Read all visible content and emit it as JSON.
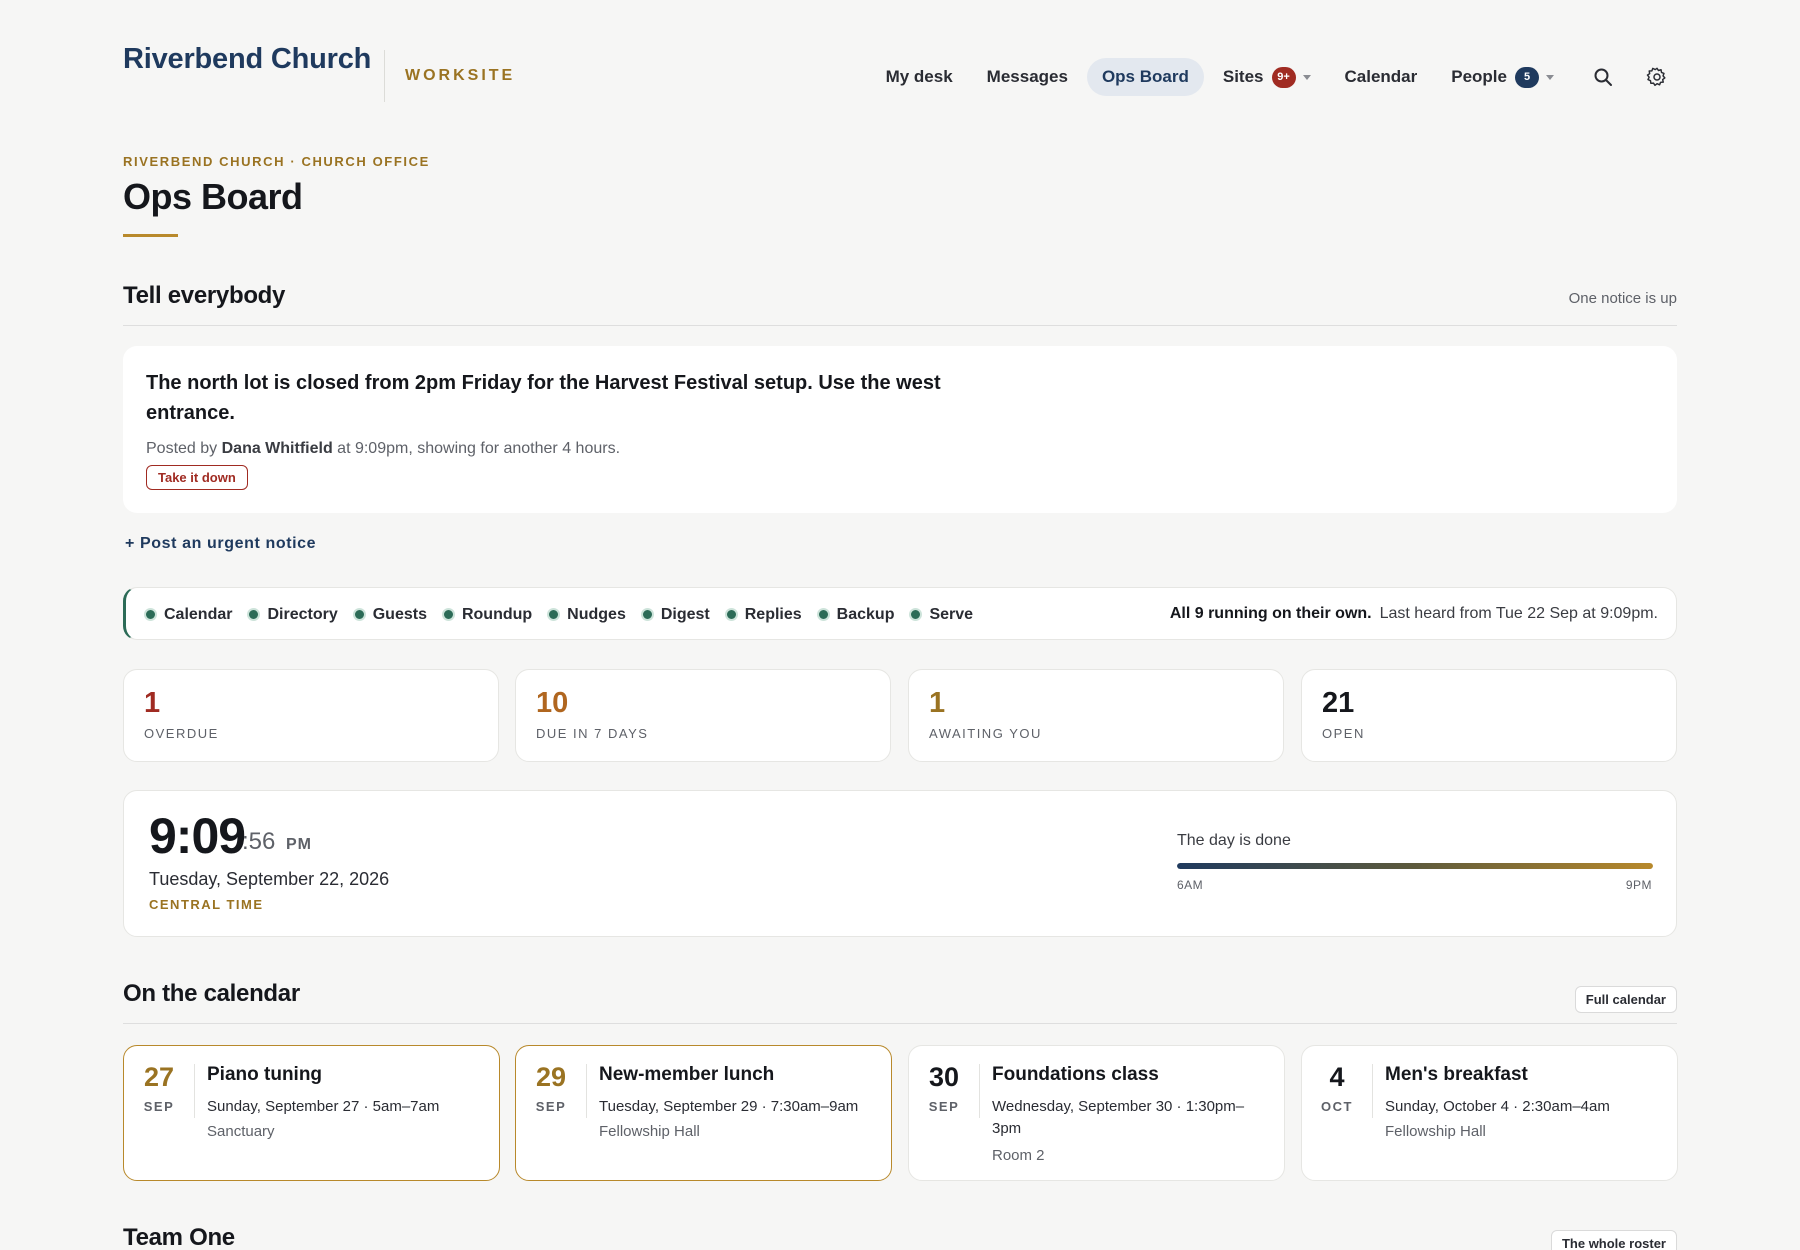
{
  "header": {
    "brand": "Riverbend Church",
    "brand_sub": "WORKSITE",
    "nav": [
      {
        "label": "My desk"
      },
      {
        "label": "Messages"
      },
      {
        "label": "Ops Board",
        "active": true
      },
      {
        "label": "Sites",
        "badge": "9+"
      },
      {
        "label": "Calendar"
      },
      {
        "label": "People",
        "badge": "5"
      }
    ],
    "icons": [
      "search-icon",
      "gear-icon"
    ]
  },
  "page": {
    "kicker": "RIVERBEND CHURCH · CHURCH OFFICE",
    "title": "Ops Board"
  },
  "notices": {
    "title": "Tell everybody",
    "meta": "One notice is up",
    "notice": {
      "text": "The north lot is closed from 2pm Friday for the Harvest Festival setup. Use the west entrance.",
      "posted_prefix": "Posted by",
      "author": "Dana Whitfield",
      "posted_suffix": "at 9:09pm, showing for another 4 hours.",
      "remove_label": "Take it down"
    },
    "post_label": "+  Post an urgent notice"
  },
  "services": {
    "items": [
      "Calendar",
      "Directory",
      "Guests",
      "Roundup",
      "Nudges",
      "Digest",
      "Replies",
      "Backup",
      "Serve"
    ],
    "summary": "All 9 running on their own.",
    "last_heard": "Last heard from Tue 22 Sep at 9:09pm.",
    "status_color": "#2c6b57"
  },
  "stats": [
    {
      "value": "1",
      "label": "OVERDUE",
      "color": "#a02b22"
    },
    {
      "value": "10",
      "label": "DUE IN 7 DAYS",
      "color": "#b0661f"
    },
    {
      "value": "1",
      "label": "AWAITING YOU",
      "color": "#9a7322"
    },
    {
      "value": "21",
      "label": "OPEN",
      "color": "#15171c"
    }
  ],
  "clock": {
    "time": "9:09",
    "seconds": ":56",
    "ampm": "PM",
    "date": "Tuesday, September 22, 2026",
    "timezone": "CENTRAL TIME",
    "day_label": "The day is done",
    "day_progress": 1.0,
    "day_start": "6AM",
    "day_end": "9PM"
  },
  "calendar": {
    "title": "On the calendar",
    "button": "Full calendar",
    "events": [
      {
        "day": "27",
        "month": "SEP",
        "title": "Piano tuning",
        "when": "Sunday, September 27 · 5am–7am",
        "where": "Sanctuary",
        "highlight": true
      },
      {
        "day": "29",
        "month": "SEP",
        "title": "New-member lunch",
        "when": "Tuesday, September 29 · 7:30am–9am",
        "where": "Fellowship Hall",
        "highlight": true
      },
      {
        "day": "30",
        "month": "SEP",
        "title": "Foundations class",
        "when": "Wednesday, September 30 · 1:30pm–3pm",
        "where": "Room 2",
        "highlight": false
      },
      {
        "day": "4",
        "month": "OCT",
        "title": "Men's breakfast",
        "when": "Sunday, October 4 · 2:30am–4am",
        "where": "Fellowship Hall",
        "highlight": false
      }
    ]
  },
  "team": {
    "title": "Team One",
    "button": "The whole roster"
  },
  "colors": {
    "accent_gold": "#b8892b",
    "brand_navy": "#1f3a5e",
    "danger": "#a02b22"
  }
}
